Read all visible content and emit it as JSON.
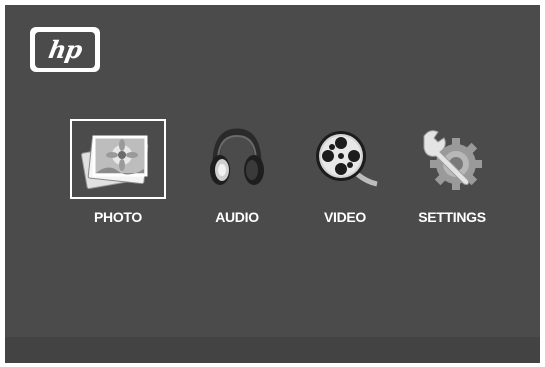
{
  "logo": {
    "text": "hp"
  },
  "menu": {
    "items": [
      {
        "id": "photo",
        "label": "PHOTO",
        "icon": "photo-icon",
        "selected": true
      },
      {
        "id": "audio",
        "label": "AUDIO",
        "icon": "headphones-icon",
        "selected": false
      },
      {
        "id": "video",
        "label": "VIDEO",
        "icon": "film-reel-icon",
        "selected": false
      },
      {
        "id": "settings",
        "label": "SETTINGS",
        "icon": "wrench-gear-icon",
        "selected": false
      }
    ]
  },
  "colors": {
    "background": "#4b4b4b",
    "bottom_bar": "#434343",
    "text": "#ffffff",
    "selection_border": "#ffffff"
  }
}
